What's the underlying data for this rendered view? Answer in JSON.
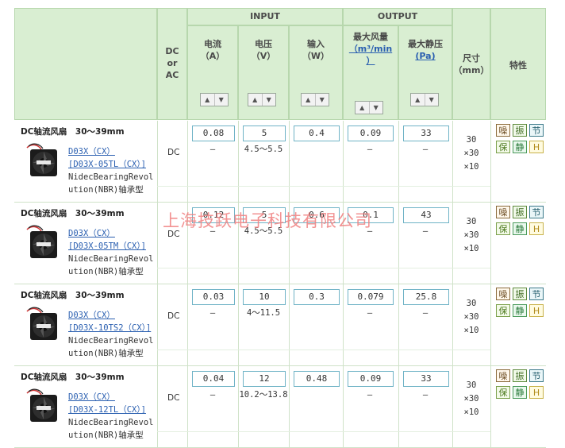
{
  "header": {
    "group_input": "INPUT",
    "group_output": "OUTPUT",
    "dc_or_ac": [
      "DC",
      "or",
      "AC"
    ],
    "current": [
      "电流",
      "（A）"
    ],
    "voltage": [
      "电压",
      "（V）"
    ],
    "power": [
      "输入",
      "（W）"
    ],
    "airflow": [
      "最大风量",
      "（m³/min",
      "）"
    ],
    "pressure": [
      "最大静压",
      "(Pa)"
    ],
    "size": [
      "尺寸",
      "（mm）"
    ],
    "features": "特性",
    "sort_up": "▲",
    "sort_down": "▼"
  },
  "watermark": "上海技跃电子科技有限公司",
  "rows": [
    {
      "title": "DC轴流风扇　30～39mm",
      "model": "D03X（CX）",
      "part": "[D03X-05TL（CX）]",
      "desc": "NidecBearingRevolution(NBR)轴承型",
      "type": "DC",
      "current": "0.08",
      "current_sub": "–",
      "voltage": "5",
      "voltage_sub": "4.5～5.5",
      "power": "0.4",
      "power_sub": "",
      "airflow": "0.09",
      "airflow_sub": "–",
      "pressure": "33",
      "pressure_sub": "–",
      "size": [
        "30",
        "×30",
        "×10"
      ],
      "badges": [
        "噪",
        "振",
        "节",
        "保",
        "静",
        "H"
      ]
    },
    {
      "title": "DC轴流风扇　30～39mm",
      "model": "D03X（CX）",
      "part": "[D03X-05TM（CX）]",
      "desc": "NidecBearingRevolution(NBR)轴承型",
      "type": "DC",
      "current": "0.12",
      "current_sub": "–",
      "voltage": "5",
      "voltage_sub": "4.5～5.5",
      "power": "0.6",
      "power_sub": "",
      "airflow": "0.1",
      "airflow_sub": "–",
      "pressure": "43",
      "pressure_sub": "–",
      "size": [
        "30",
        "×30",
        "×10"
      ],
      "badges": [
        "噪",
        "振",
        "节",
        "保",
        "静",
        "H"
      ]
    },
    {
      "title": "DC轴流风扇　30～39mm",
      "model": "D03X（CX）",
      "part": "[D03X-10TS2（CX）]",
      "desc": "NidecBearingRevolution(NBR)轴承型",
      "type": "DC",
      "current": "0.03",
      "current_sub": "–",
      "voltage": "10",
      "voltage_sub": "4～11.5",
      "power": "0.3",
      "power_sub": "",
      "airflow": "0.079",
      "airflow_sub": "–",
      "pressure": "25.8",
      "pressure_sub": "–",
      "size": [
        "30",
        "×30",
        "×10"
      ],
      "badges": [
        "噪",
        "振",
        "节",
        "保",
        "静",
        "H"
      ]
    },
    {
      "title": "DC轴流风扇　30～39mm",
      "model": "D03X（CX）",
      "part": "[D03X-12TL（CX）]",
      "desc": "NidecBearingRevolution(NBR)轴承型",
      "type": "DC",
      "current": "0.04",
      "current_sub": "–",
      "voltage": "12",
      "voltage_sub": "10.2～13.8",
      "power": "0.48",
      "power_sub": "",
      "airflow": "0.09",
      "airflow_sub": "–",
      "pressure": "33",
      "pressure_sub": "–",
      "size": [
        "30",
        "×30",
        "×10"
      ],
      "badges": [
        "噪",
        "振",
        "节",
        "保",
        "静",
        "H"
      ]
    }
  ]
}
